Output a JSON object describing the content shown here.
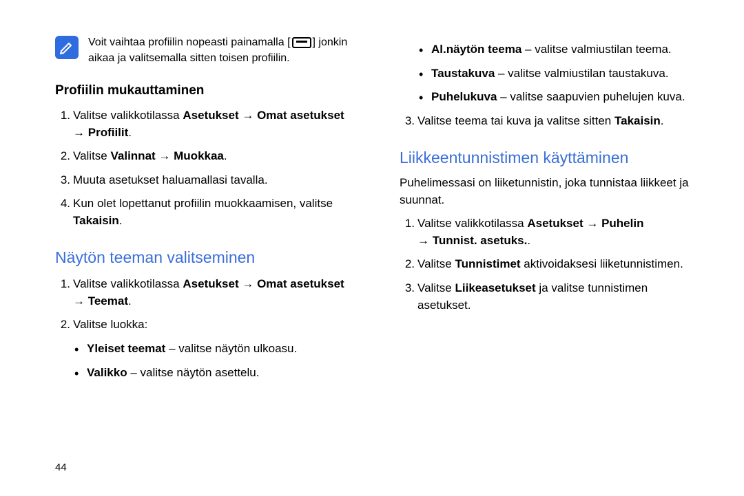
{
  "page_number": "44",
  "left": {
    "note": {
      "part1": "Voit vaihtaa profiilin nopeasti painamalla [",
      "part2": "] jonkin aikaa ja valitsemalla sitten toisen profiilin."
    },
    "sectionA": {
      "title": "Profiilin mukauttaminen",
      "steps": {
        "1a": "Valitse valikkotilassa ",
        "1b": "Asetukset",
        "1c": "Omat asetukset",
        "1d": "Profiilit",
        "2a": "Valitse ",
        "2b": "Valinnat",
        "2c": "Muokkaa",
        "3": "Muuta asetukset haluamallasi tavalla.",
        "4a": "Kun olet lopettanut profiilin muokkaamisen, valitse ",
        "4b": "Takaisin"
      }
    },
    "sectionB": {
      "title": "Näytön teeman valitseminen",
      "steps": {
        "1a": "Valitse valikkotilassa ",
        "1b": "Asetukset",
        "1c": "Omat asetukset",
        "1d": "Teemat",
        "2": "Valitse luokka:",
        "bullets": {
          "b1a": "Yleiset teemat",
          "b1b": " – valitse näytön ulkoasu.",
          "b2a": "Valikko",
          "b2b": " – valitse näytön asettelu."
        }
      }
    }
  },
  "right": {
    "top_bullets": {
      "b1a": "Al.näytön teema",
      "b1b": " – valitse valmiustilan teema.",
      "b2a": "Taustakuva",
      "b2b": " – valitse valmiustilan taustakuva.",
      "b3a": "Puhelukuva",
      "b3b": " – valitse saapuvien puhelujen kuva."
    },
    "step3a": "Valitse teema tai kuva ja valitse sitten ",
    "step3b": "Takaisin",
    "sectionC": {
      "title": "Liikkeentunnistimen käyttäminen",
      "intro": "Puhelimessasi on liiketunnistin, joka tunnistaa liikkeet ja suunnat.",
      "steps": {
        "1a": "Valitse valikkotilassa ",
        "1b": "Asetukset",
        "1c": "Puhelin",
        "1d": "Tunnist. asetuks.",
        "2a": "Valitse ",
        "2b": "Tunnistimet",
        "2c": " aktivoidaksesi liiketunnistimen.",
        "3a": "Valitse ",
        "3b": "Liikeasetukset",
        "3c": " ja valitse tunnistimen asetukset."
      }
    }
  }
}
